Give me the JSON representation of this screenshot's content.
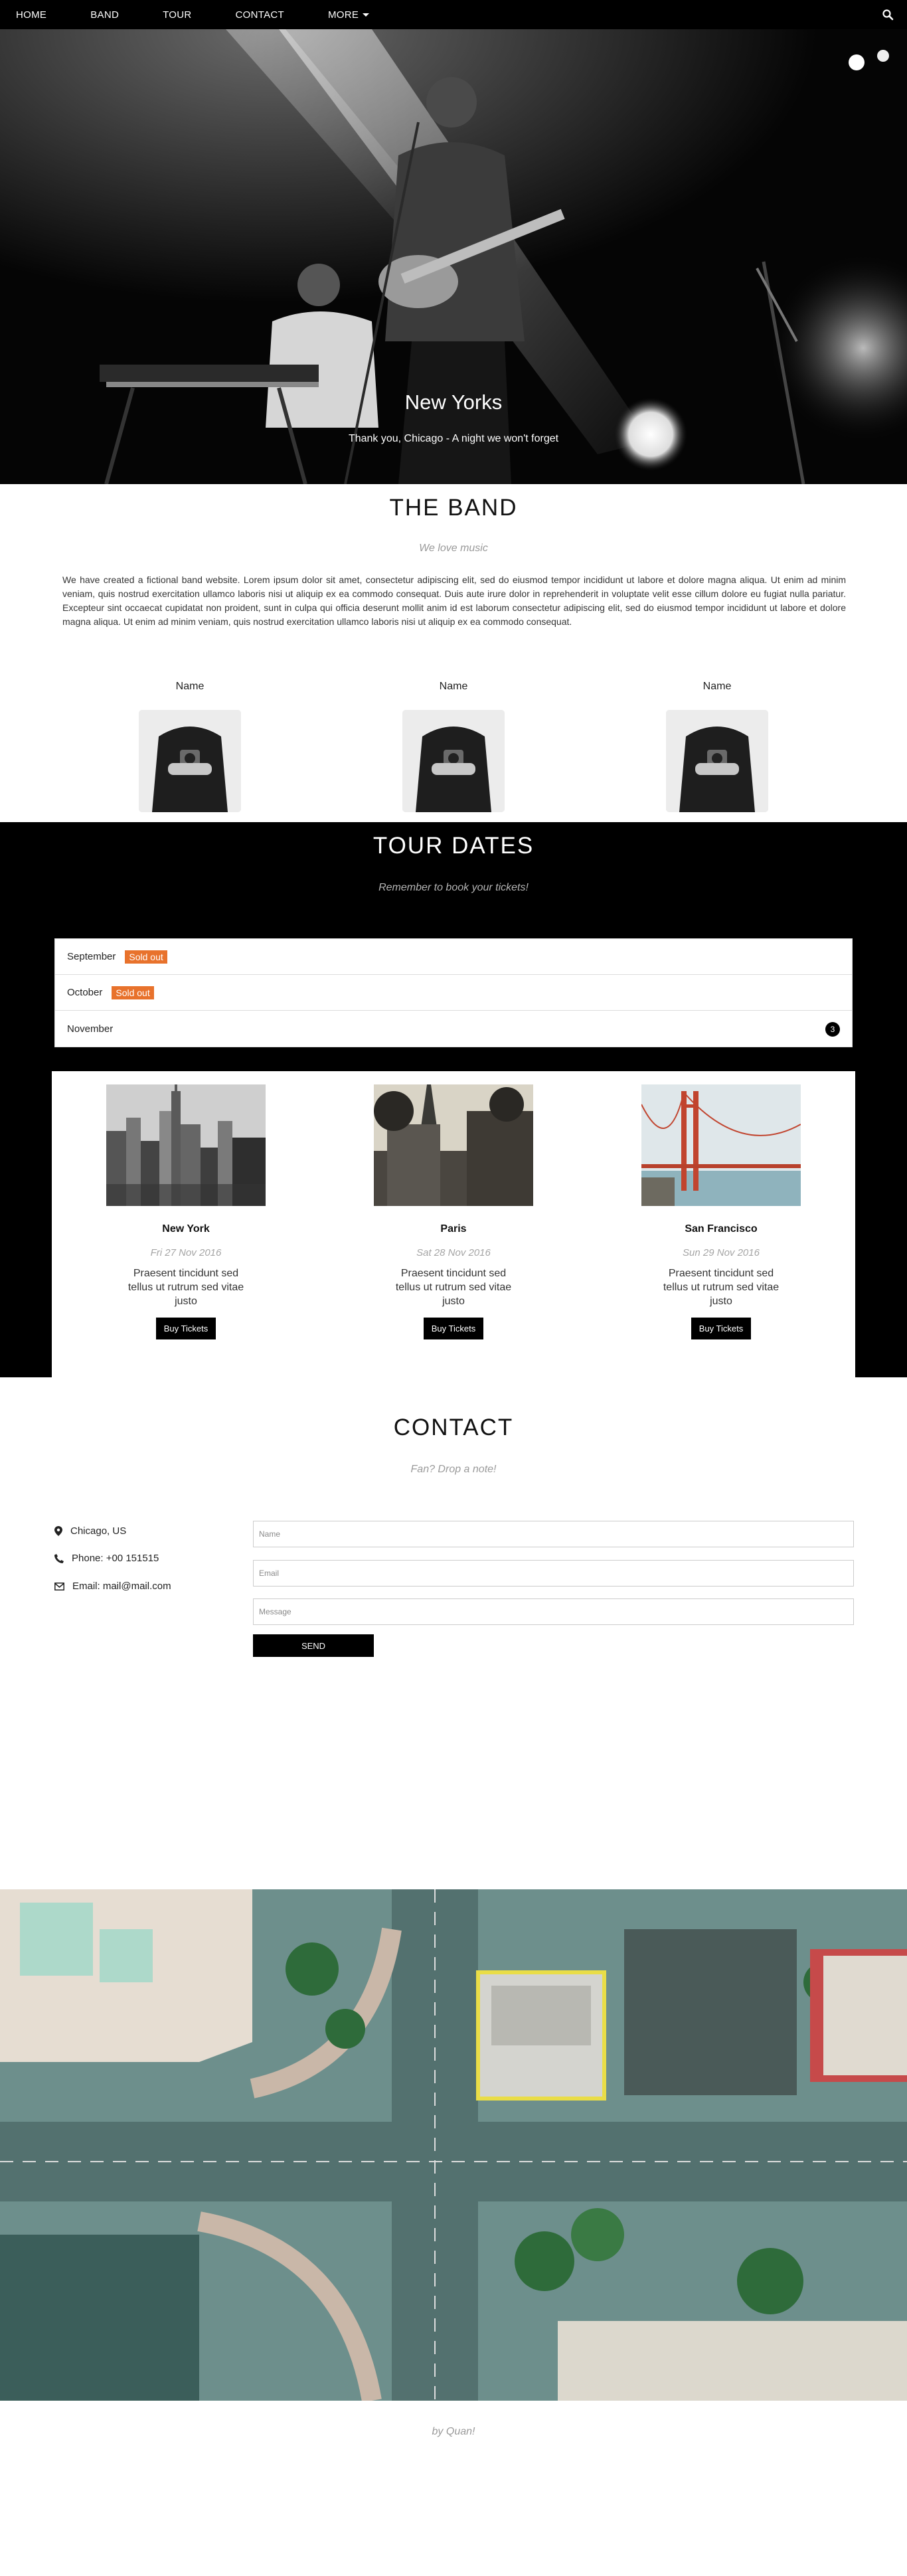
{
  "nav": {
    "items": [
      {
        "label": "HOME"
      },
      {
        "label": "BAND"
      },
      {
        "label": "TOUR"
      },
      {
        "label": "CONTACT"
      },
      {
        "label": "MORE"
      }
    ],
    "icon": "search-icon"
  },
  "hero": {
    "title": "New Yorks",
    "subtitle": "Thank you, Chicago - A night we won't forget"
  },
  "band": {
    "title": "THE BAND",
    "subtitle": "We love music",
    "text": "We have created a fictional band website. Lorem ipsum dolor sit amet, consectetur adipiscing elit, sed do eiusmod tempor incididunt ut labore et dolore magna aliqua. Ut enim ad minim veniam, quis nostrud exercitation ullamco laboris nisi ut aliquip ex ea commodo consequat. Duis aute irure dolor in reprehenderit in voluptate velit esse cillum dolore eu fugiat nulla pariatur. Excepteur sint occaecat cupidatat non proident, sunt in culpa qui officia deserunt mollit anim id est laborum consectetur adipiscing elit, sed do eiusmod tempor incididunt ut labore et dolore magna aliqua. Ut enim ad minim veniam, quis nostrud exercitation ullamco laboris nisi ut aliquip ex ea commodo consequat.",
    "members": [
      {
        "name": "Name"
      },
      {
        "name": "Name"
      },
      {
        "name": "Name"
      }
    ]
  },
  "tour": {
    "title": "TOUR DATES",
    "subtitle": "Remember to book your tickets!",
    "months": [
      {
        "month": "September",
        "badge": "Sold out"
      },
      {
        "month": "October",
        "badge": "Sold out"
      },
      {
        "month": "November",
        "count": "3"
      }
    ],
    "cards": [
      {
        "city": "New York",
        "date": "Fri 27 Nov 2016",
        "desc": "Praesent tincidunt sed tellus ut rutrum sed vitae justo",
        "button": "Buy Tickets"
      },
      {
        "city": "Paris",
        "date": "Sat 28 Nov 2016",
        "desc": "Praesent tincidunt sed tellus ut rutrum sed vitae justo",
        "button": "Buy Tickets"
      },
      {
        "city": "San Francisco",
        "date": "Sun 29 Nov 2016",
        "desc": "Praesent tincidunt sed tellus ut rutrum sed vitae justo",
        "button": "Buy Tickets"
      }
    ],
    "soldout_color": "#e8722c"
  },
  "contact": {
    "title": "CONTACT",
    "subtitle": "Fan? Drop a note!",
    "location": "Chicago, US",
    "phone": "Phone: +00 151515",
    "email": "Email: mail@mail.com",
    "name_placeholder": "Name",
    "email_placeholder": "Email",
    "message_placeholder": "Message",
    "send_label": "SEND"
  },
  "footer": {
    "text": "by Quan!"
  }
}
